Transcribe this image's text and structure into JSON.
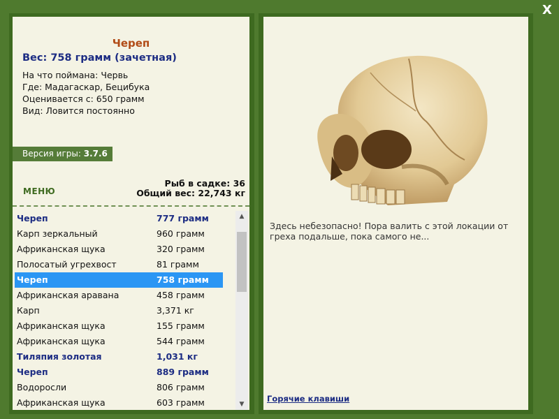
{
  "window": {
    "close_label": "X"
  },
  "fish": {
    "name": "Череп",
    "weight_line": "Вес: 758 грамм (зачетная)",
    "info": [
      "На что поймана: Червь",
      "Где: Мадагаскар, Бецибука",
      "Оценивается с: 650 грамм",
      "Вид: Ловится постоянно"
    ],
    "description": "Здесь небезопасно! Пора валить с этой локации от греха подальше, пока самого не..."
  },
  "version": {
    "label": "Версия игры:",
    "value": "3.7.6"
  },
  "menu_label": "МЕНЮ",
  "stats": {
    "fish_count": "Рыб в садке: 36",
    "total_weight": "Общий вес: 22,743 кг"
  },
  "catch_list": [
    {
      "name": "Череп",
      "weight": "777 грамм",
      "style": "bold"
    },
    {
      "name": "Карп зеркальный",
      "weight": "960 грамм",
      "style": "normal"
    },
    {
      "name": "Африканская щука",
      "weight": "320 грамм",
      "style": "normal"
    },
    {
      "name": "Полосатый угрехвост",
      "weight": "81 грамм",
      "style": "normal"
    },
    {
      "name": "Череп",
      "weight": "758 грамм",
      "style": "selected"
    },
    {
      "name": "Африканская аравана",
      "weight": "458 грамм",
      "style": "normal"
    },
    {
      "name": "Карп",
      "weight": "3,371 кг",
      "style": "normal"
    },
    {
      "name": "Африканская щука",
      "weight": "155 грамм",
      "style": "normal"
    },
    {
      "name": "Африканская щука",
      "weight": "544 грамм",
      "style": "normal"
    },
    {
      "name": "Тиляпия золотая",
      "weight": "1,031 кг",
      "style": "bold"
    },
    {
      "name": "Череп",
      "weight": "889 грамм",
      "style": "bold"
    },
    {
      "name": "Водоросли",
      "weight": "806 грамм",
      "style": "normal"
    },
    {
      "name": "Африканская щука",
      "weight": "603 грамм",
      "style": "normal"
    }
  ],
  "hotkeys_label": "Горячие клавиши",
  "colors": {
    "frame_green": "#4f7a2e",
    "panel_bg": "#f4f3e4",
    "title_orange": "#b14b16",
    "navy": "#1c2c83",
    "selection_blue": "#2b96f4"
  },
  "icons": {
    "close": "close-icon",
    "scroll_up": "chevron-up-icon",
    "scroll_down": "chevron-down-icon",
    "image": "skull-image"
  }
}
